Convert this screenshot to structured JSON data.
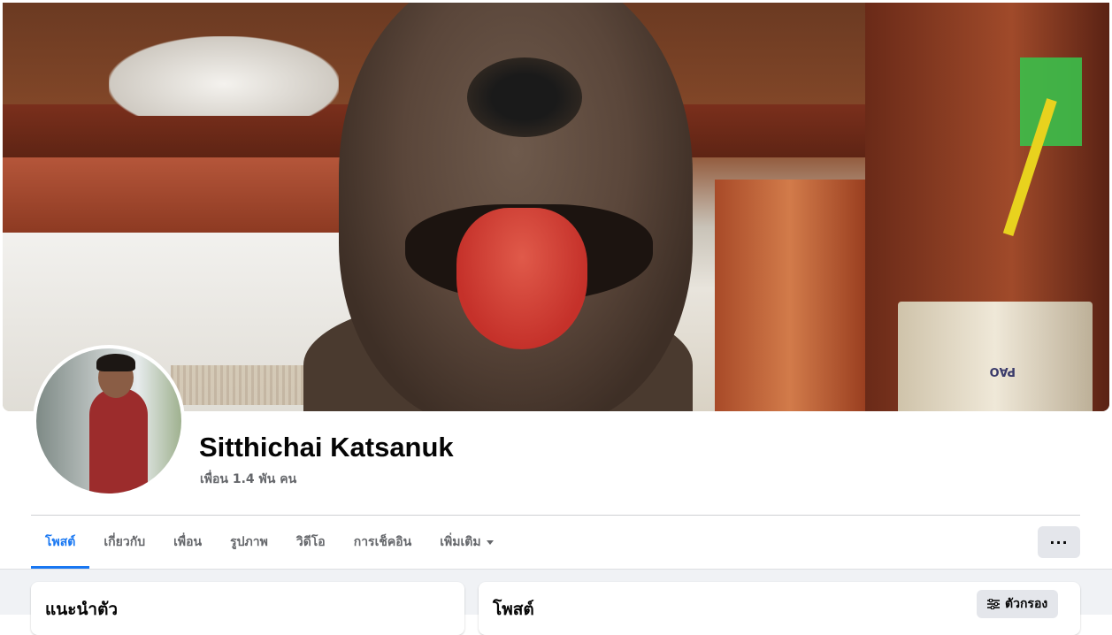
{
  "profile": {
    "name": "Sitthichai Katsanuk",
    "friends_count": "เพื่อน 1.4 พัน คน"
  },
  "cover": {
    "bucket_text": "PAO"
  },
  "tabs": [
    {
      "label": "โพสต์",
      "active": true
    },
    {
      "label": "เกี่ยวกับ",
      "active": false
    },
    {
      "label": "เพื่อน",
      "active": false
    },
    {
      "label": "รูปภาพ",
      "active": false
    },
    {
      "label": "วิดีโอ",
      "active": false
    },
    {
      "label": "การเช็คอิน",
      "active": false
    },
    {
      "label": "เพิ่มเติม",
      "active": false
    }
  ],
  "actions": {
    "more_label": "···"
  },
  "intro_card": {
    "title": "แนะนำตัว"
  },
  "posts_card": {
    "title": "โพสต์",
    "filter_label": "ตัวกรอง"
  },
  "colors": {
    "accent": "#1877f2",
    "text_secondary": "#65676b",
    "button_bg": "#e4e6eb",
    "feed_bg": "#f0f2f5"
  },
  "icons": {
    "more": "ellipsis-icon",
    "dropdown": "caret-down-icon",
    "filter": "sliders-icon"
  }
}
